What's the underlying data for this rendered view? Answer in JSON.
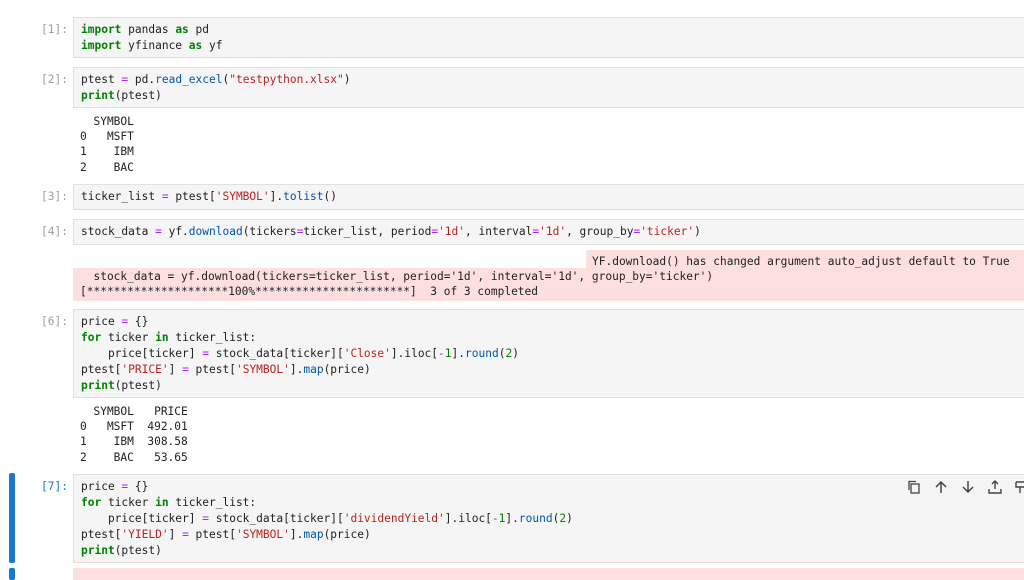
{
  "cells": [
    {
      "prompt": "[1]:",
      "lines": [
        [
          {
            "t": "import",
            "c": "kw"
          },
          {
            "t": " pandas "
          },
          {
            "t": "as",
            "c": "kw"
          },
          {
            "t": " pd"
          }
        ],
        [
          {
            "t": "import",
            "c": "kw"
          },
          {
            "t": " yfinance "
          },
          {
            "t": "as",
            "c": "kw"
          },
          {
            "t": " yf"
          }
        ]
      ]
    },
    {
      "prompt": "[2]:",
      "lines": [
        [
          {
            "t": "ptest "
          },
          {
            "t": "=",
            "c": "op"
          },
          {
            "t": " pd."
          },
          {
            "t": "read_excel",
            "c": "fn"
          },
          {
            "t": "("
          },
          {
            "t": "\"testpython.xlsx\"",
            "c": "str"
          },
          {
            "t": ")"
          }
        ],
        [
          {
            "t": "print",
            "c": "kw"
          },
          {
            "t": "(ptest)"
          }
        ]
      ],
      "output": "  SYMBOL\n0   MSFT\n1    IBM\n2    BAC"
    },
    {
      "prompt": "[3]:",
      "lines": [
        [
          {
            "t": "ticker_list "
          },
          {
            "t": "=",
            "c": "op"
          },
          {
            "t": " ptest["
          },
          {
            "t": "'SYMBOL'",
            "c": "str"
          },
          {
            "t": "]."
          },
          {
            "t": "tolist",
            "c": "fn"
          },
          {
            "t": "()"
          }
        ]
      ]
    },
    {
      "prompt": "[4]:",
      "lines": [
        [
          {
            "t": "stock_data "
          },
          {
            "t": "=",
            "c": "op"
          },
          {
            "t": " yf."
          },
          {
            "t": "download",
            "c": "fn"
          },
          {
            "t": "(tickers"
          },
          {
            "t": "=",
            "c": "op"
          },
          {
            "t": "ticker_list, period"
          },
          {
            "t": "=",
            "c": "op"
          },
          {
            "t": "'1d'",
            "c": "str"
          },
          {
            "t": ", interval"
          },
          {
            "t": "=",
            "c": "op"
          },
          {
            "t": "'1d'",
            "c": "str"
          },
          {
            "t": ", group_by"
          },
          {
            "t": "=",
            "c": "op"
          },
          {
            "t": "'ticker'",
            "c": "str"
          },
          {
            "t": ")"
          }
        ]
      ],
      "stderr": {
        "warning": "YF.download() has changed argument auto_adjust default to True",
        "line1": "  stock_data = yf.download(tickers=ticker_list, period='1d', interval='1d', group_by='ticker')",
        "line2": "[*********************100%***********************]  3 of 3 completed"
      }
    },
    {
      "prompt": "[6]:",
      "lines": [
        [
          {
            "t": "price "
          },
          {
            "t": "=",
            "c": "op"
          },
          {
            "t": " {}"
          }
        ],
        [
          {
            "t": "for",
            "c": "kw"
          },
          {
            "t": " ticker "
          },
          {
            "t": "in",
            "c": "kw"
          },
          {
            "t": " ticker_list:"
          }
        ],
        [
          {
            "t": "    price[ticker] "
          },
          {
            "t": "=",
            "c": "op"
          },
          {
            "t": " stock_data[ticker]["
          },
          {
            "t": "'Close'",
            "c": "str"
          },
          {
            "t": "].iloc["
          },
          {
            "t": "-",
            "c": "op"
          },
          {
            "t": "1",
            "c": "num"
          },
          {
            "t": "]."
          },
          {
            "t": "round",
            "c": "fn"
          },
          {
            "t": "("
          },
          {
            "t": "2",
            "c": "num"
          },
          {
            "t": ")"
          }
        ],
        [
          {
            "t": "ptest["
          },
          {
            "t": "'PRICE'",
            "c": "str"
          },
          {
            "t": "] "
          },
          {
            "t": "=",
            "c": "op"
          },
          {
            "t": " ptest["
          },
          {
            "t": "'SYMBOL'",
            "c": "str"
          },
          {
            "t": "]."
          },
          {
            "t": "map",
            "c": "fn"
          },
          {
            "t": "(price)"
          }
        ],
        [
          {
            "t": "print",
            "c": "kw"
          },
          {
            "t": "(ptest)"
          }
        ]
      ],
      "output": "  SYMBOL   PRICE\n0   MSFT  492.01\n1    IBM  308.58\n2    BAC   53.65"
    },
    {
      "prompt": "[7]:",
      "lines": [
        [
          {
            "t": "price "
          },
          {
            "t": "=",
            "c": "op"
          },
          {
            "t": " {}"
          }
        ],
        [
          {
            "t": "for",
            "c": "kw"
          },
          {
            "t": " ticker "
          },
          {
            "t": "in",
            "c": "kw"
          },
          {
            "t": " ticker_list:"
          }
        ],
        [
          {
            "t": "    price[ticker] "
          },
          {
            "t": "=",
            "c": "op"
          },
          {
            "t": " stock_data[ticker]["
          },
          {
            "t": "'dividendYield'",
            "c": "str"
          },
          {
            "t": "].iloc["
          },
          {
            "t": "-",
            "c": "op"
          },
          {
            "t": "1",
            "c": "num"
          },
          {
            "t": "]."
          },
          {
            "t": "round",
            "c": "fn"
          },
          {
            "t": "("
          },
          {
            "t": "2",
            "c": "num"
          },
          {
            "t": ")"
          }
        ],
        [
          {
            "t": "ptest["
          },
          {
            "t": "'YIELD'",
            "c": "str"
          },
          {
            "t": "] "
          },
          {
            "t": "=",
            "c": "op"
          },
          {
            "t": " ptest["
          },
          {
            "t": "'SYMBOL'",
            "c": "str"
          },
          {
            "t": "]."
          },
          {
            "t": "map",
            "c": "fn"
          },
          {
            "t": "(price)"
          }
        ],
        [
          {
            "t": "print",
            "c": "kw"
          },
          {
            "t": "(ptest)"
          }
        ]
      ]
    }
  ],
  "toolbar": {
    "icons": [
      "duplicate-icon",
      "move-up-icon",
      "move-down-icon",
      "insert-above-icon",
      "insert-below-icon"
    ]
  }
}
